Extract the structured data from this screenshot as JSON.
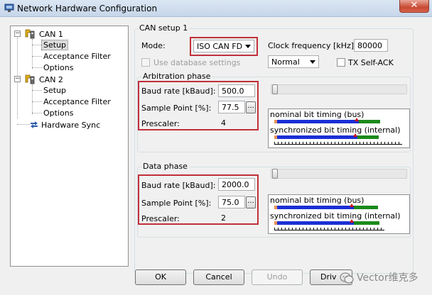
{
  "window": {
    "title": "Network Hardware Configuration",
    "close_symbol": "✕"
  },
  "tree": {
    "can1": {
      "label": "CAN 1",
      "toggle": "−",
      "children": [
        "Setup",
        "Acceptance Filter",
        "Options"
      ],
      "selected": "Setup"
    },
    "can2": {
      "label": "CAN 2",
      "toggle": "−",
      "children": [
        "Setup",
        "Acceptance Filter",
        "Options"
      ]
    },
    "hardware_sync": {
      "label": "Hardware Sync"
    }
  },
  "can_setup": {
    "group_label": "CAN setup 1",
    "mode_label": "Mode:",
    "mode_value": "ISO CAN FD",
    "clock_label": "Clock frequency [kHz]:",
    "clock_value": "80000",
    "use_db_label": "Use database settings",
    "mode2_value": "Normal",
    "tx_self_ack_label": "TX Self-ACK"
  },
  "arbitration": {
    "group_label": "Arbitration phase",
    "baud_label": "Baud rate [kBaud]:",
    "baud_value": "500.0",
    "sample_label": "Sample Point [%]:",
    "sample_value": "77.5",
    "prescaler_label": "Prescaler:",
    "prescaler_value": "4",
    "dots_label": "...",
    "nominal_label": "nominal bit timing (bus)",
    "sync_label": "synchronized bit timing (internal)",
    "sample_point_percent": 77.5
  },
  "data_phase": {
    "group_label": "Data phase",
    "baud_label": "Baud rate [kBaud]:",
    "baud_value": "2000.0",
    "sample_label": "Sample Point [%]:",
    "sample_value": "75.0",
    "prescaler_label": "Prescaler:",
    "prescaler_value": "2",
    "dots_label": "...",
    "nominal_label": "nominal bit timing (bus)",
    "sync_label": "synchronized bit timing (internal)",
    "sample_point_percent": 75.0
  },
  "buttons": {
    "ok": "OK",
    "cancel": "Cancel",
    "undo": "Undo",
    "driver": "Driv"
  },
  "watermark": {
    "text": "Vector维克多"
  },
  "colors": {
    "highlight_box": "#c0303a",
    "bit_blue": "#1a2fd6",
    "bit_green": "#1b8a1b",
    "bit_sync_orange": "#e8935a",
    "marker_red": "#cc1111"
  }
}
